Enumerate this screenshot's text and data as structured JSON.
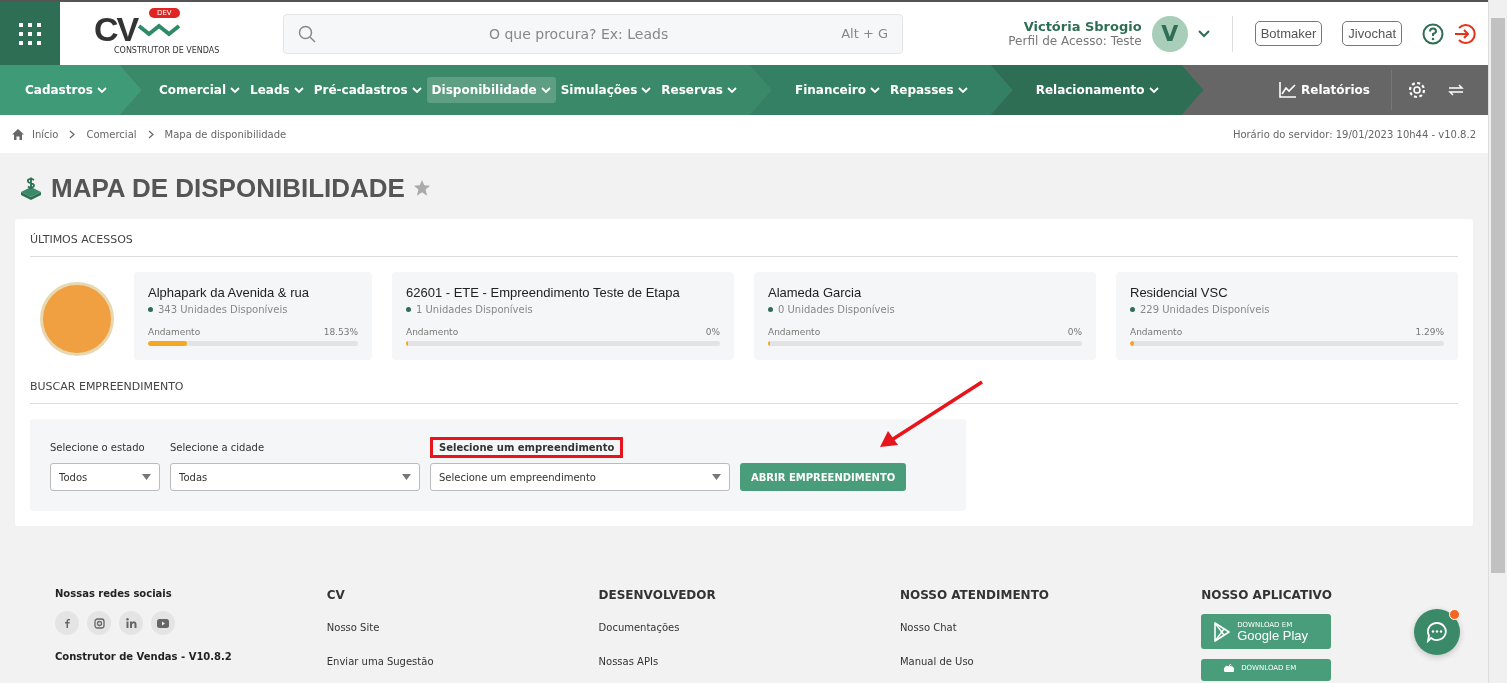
{
  "header": {
    "logo": {
      "text": "CV",
      "badge": "DEV",
      "tagline": "CONSTRUTOR DE VENDAS"
    },
    "search": {
      "placeholder": "O que procura? Ex: Leads",
      "shortcut": "Alt + G"
    },
    "user": {
      "name": "Victória Sbrogio",
      "profile": "Perfil de Acesso: Teste",
      "initial": "V"
    },
    "buttons": [
      "Botmaker",
      "Jivochat"
    ]
  },
  "nav": {
    "groups": [
      {
        "items": [
          {
            "label": "Cadastros",
            "selected": false
          }
        ]
      },
      {
        "items": [
          {
            "label": "Comercial",
            "selected": false
          },
          {
            "label": "Leads",
            "selected": false
          },
          {
            "label": "Pré-cadastros",
            "selected": false
          },
          {
            "label": "Disponibilidade",
            "selected": true
          },
          {
            "label": "Simulações",
            "selected": false
          },
          {
            "label": "Reservas",
            "selected": false
          }
        ]
      },
      {
        "items": [
          {
            "label": "Financeiro",
            "selected": false
          },
          {
            "label": "Repasses",
            "selected": false
          }
        ]
      },
      {
        "items": [
          {
            "label": "Relacionamento",
            "selected": false
          }
        ]
      }
    ],
    "reports": "Relatórios"
  },
  "breadcrumb": [
    "Início",
    "Comercial",
    "Mapa de disponibilidade"
  ],
  "server_time": "Horário do servidor: 19/01/2023 10h44 - v10.8.2",
  "page_title": "MAPA DE DISPONIBILIDADE",
  "recent": {
    "title": "ÚLTIMOS ACESSOS",
    "items": [
      {
        "name": "Alphapark da Avenida & rua",
        "units": "343 Unidades Disponíveis",
        "progress_label": "Andamento",
        "reading": "18.53%",
        "level": 0.1853,
        "has_logo": true
      },
      {
        "name": "62601 - ETE - Empreendimento Teste de Etapa",
        "units": "1 Unidades Disponíveis",
        "progress_label": "Andamento",
        "reading": "0%",
        "level": 0,
        "has_logo": false
      },
      {
        "name": "Alameda Garcia",
        "units": "0 Unidades Disponíveis",
        "progress_label": "Andamento",
        "reading": "0%",
        "level": 0,
        "has_logo": false
      },
      {
        "name": "Residencial VSC",
        "units": "229 Unidades Disponíveis",
        "progress_label": "Andamento",
        "reading": "1.29%",
        "level": 0.0129,
        "has_logo": false
      }
    ]
  },
  "search_section": {
    "title": "BUSCAR EMPREENDIMENTO",
    "filters": [
      {
        "label": "Selecione o estado",
        "value": "Todos",
        "highlighted": false
      },
      {
        "label": "Selecione a cidade",
        "value": "Todas",
        "highlighted": false
      },
      {
        "label": "Selecione um empreendimento",
        "value": "Selecione um empreendimento",
        "highlighted": true
      }
    ],
    "button": "ABRIR EMPREENDIMENTO"
  },
  "footer": {
    "social_title": "Nossas redes sociais",
    "version": "Construtor de Vendas - V10.8.2",
    "columns": [
      {
        "title": "CV",
        "links": [
          "Nosso Site",
          "Enviar uma Sugestão"
        ]
      },
      {
        "title": "DESENVOLVEDOR",
        "links": [
          "Documentações",
          "Nossas APIs"
        ]
      },
      {
        "title": "NOSSO ATENDIMENTO",
        "links": [
          "Nosso Chat",
          "Manual de Uso"
        ]
      }
    ],
    "app": {
      "title": "NOSSO APLICATIVO",
      "badges": [
        {
          "small": "DOWNLOAD EM",
          "big": "Google Play"
        },
        {
          "small": "DOWNLOAD EM"
        }
      ]
    }
  }
}
